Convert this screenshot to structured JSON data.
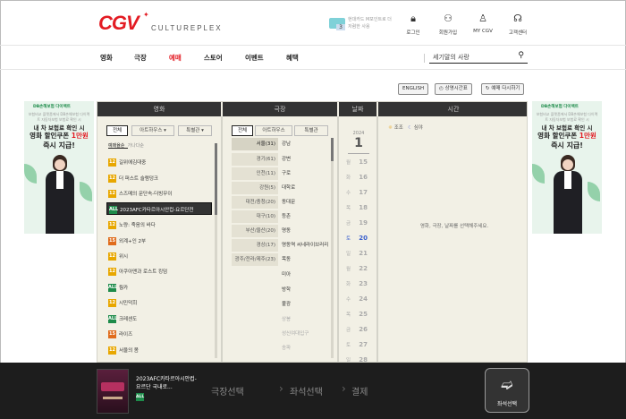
{
  "header": {
    "logo": "CGV",
    "tagline": "CULTUREPLEX",
    "promo_num": "3",
    "promo_text": "현대카드 M포인트로 더 저렴한 사용",
    "util": [
      {
        "label": "로그인",
        "icon": "lock-icon"
      },
      {
        "label": "회원가입",
        "icon": "user-plus-icon"
      },
      {
        "label": "MY CGV",
        "icon": "user-icon"
      },
      {
        "label": "고객센터",
        "icon": "headset-icon"
      }
    ]
  },
  "nav": {
    "items": [
      "영화",
      "극장",
      "예매",
      "스토어",
      "이벤트",
      "혜택"
    ],
    "active": "예매",
    "search_text": "세기말의 사랑"
  },
  "top_buttons": {
    "english": "ENGLISH",
    "timetable": "상영시간표",
    "reset": "예매 다시하기"
  },
  "ad": {
    "brand": "DB손해보험 다이렉트",
    "small": "보험비교 플랫폼에서 DB손해보험 다이렉트 자동차보험 보험료 확인 시",
    "line1": "내 차 보험료 확인 시",
    "line2_prefix": "영화 할인쿠폰 ",
    "line2_highlight": "1만원",
    "line3": "즉시 지급!"
  },
  "booking": {
    "headers": {
      "movie": "영화",
      "theater": "극장",
      "date": "날짜",
      "time": "시간"
    },
    "movie_tabs": [
      "전체",
      "아트하우스 ▾",
      "특별관 ▾"
    ],
    "sort_active": "예매율순",
    "sort_other": "가나다순",
    "movies": [
      {
        "rating": "12",
        "color": "#e8a700",
        "title": "길위에김대중"
      },
      {
        "rating": "12",
        "color": "#e8a700",
        "title": "더 퍼스트 슬램덩크"
      },
      {
        "rating": "12",
        "color": "#e8a700",
        "title": "스즈메의 문단속-더빙무이"
      },
      {
        "rating": "ALL",
        "color": "#1d8b4a",
        "title": "2023AFC카타르아시안컵-요르단전",
        "selected": true
      },
      {
        "rating": "12",
        "color": "#e8a700",
        "title": "노량: 죽음의 바다"
      },
      {
        "rating": "15",
        "color": "#e06c1c",
        "title": "외계+인 2부"
      },
      {
        "rating": "12",
        "color": "#e8a700",
        "title": "위시"
      },
      {
        "rating": "12",
        "color": "#e8a700",
        "title": "아쿠아맨과 로스트 킹덤"
      },
      {
        "rating": "ALL",
        "color": "#1d8b4a",
        "title": "웡카"
      },
      {
        "rating": "12",
        "color": "#e8a700",
        "title": "시민덕희"
      },
      {
        "rating": "ALL",
        "color": "#1d8b4a",
        "title": "크레센도"
      },
      {
        "rating": "15",
        "color": "#e06c1c",
        "title": "라이즈"
      },
      {
        "rating": "12",
        "color": "#e8a700",
        "title": "서울의 봄"
      }
    ],
    "theater_tabs": [
      "전체",
      "아트하우스",
      "특별관"
    ],
    "regions": [
      "서울(31)",
      "경기(61)",
      "인천(11)",
      "강원(5)",
      "대전/충청(20)",
      "대구(10)",
      "부산/울산(20)",
      "경상(17)",
      "광주/전라/제주(23)"
    ],
    "theaters": [
      {
        "name": "강남",
        "dim": false
      },
      {
        "name": "강변",
        "dim": false
      },
      {
        "name": "구로",
        "dim": false
      },
      {
        "name": "대학로",
        "dim": false
      },
      {
        "name": "동대문",
        "dim": false
      },
      {
        "name": "등촌",
        "dim": false
      },
      {
        "name": "명동",
        "dim": false
      },
      {
        "name": "명동역 씨네라이브러리",
        "dim": false
      },
      {
        "name": "목동",
        "dim": false
      },
      {
        "name": "미아",
        "dim": false
      },
      {
        "name": "방학",
        "dim": false
      },
      {
        "name": "불광",
        "dim": false
      },
      {
        "name": "상봉",
        "dim": true
      },
      {
        "name": "성신여대입구",
        "dim": true
      },
      {
        "name": "송파",
        "dim": true
      }
    ],
    "year": "2024",
    "month": "1",
    "dates": [
      {
        "wd": "월",
        "dn": "15",
        "today": false
      },
      {
        "wd": "화",
        "dn": "16",
        "today": false
      },
      {
        "wd": "수",
        "dn": "17",
        "today": false
      },
      {
        "wd": "목",
        "dn": "18",
        "today": false
      },
      {
        "wd": "금",
        "dn": "19",
        "today": false
      },
      {
        "wd": "토",
        "dn": "20",
        "today": true
      },
      {
        "wd": "일",
        "dn": "21",
        "today": false
      },
      {
        "wd": "월",
        "dn": "22",
        "today": false
      },
      {
        "wd": "화",
        "dn": "23",
        "today": false
      },
      {
        "wd": "수",
        "dn": "24",
        "today": false
      },
      {
        "wd": "목",
        "dn": "25",
        "today": false
      },
      {
        "wd": "금",
        "dn": "26",
        "today": false
      },
      {
        "wd": "토",
        "dn": "27",
        "today": false
      },
      {
        "wd": "일",
        "dn": "28",
        "today": false
      }
    ],
    "time_filter": {
      "morning": "조조",
      "night": "심야"
    },
    "time_message": "영화, 극장, 날짜를 선택해주세요."
  },
  "footer": {
    "title": "2023AFC카타르아시안컵-요르단 국내로...",
    "rating": "ALL",
    "step1": "극장선택",
    "step2": "좌석선택",
    "step3": "결제",
    "seat_button": "좌석선택"
  },
  "colors": {
    "brand": "#e31b23",
    "footer": "#1d1d1d",
    "panel": "#f2f0e5"
  }
}
